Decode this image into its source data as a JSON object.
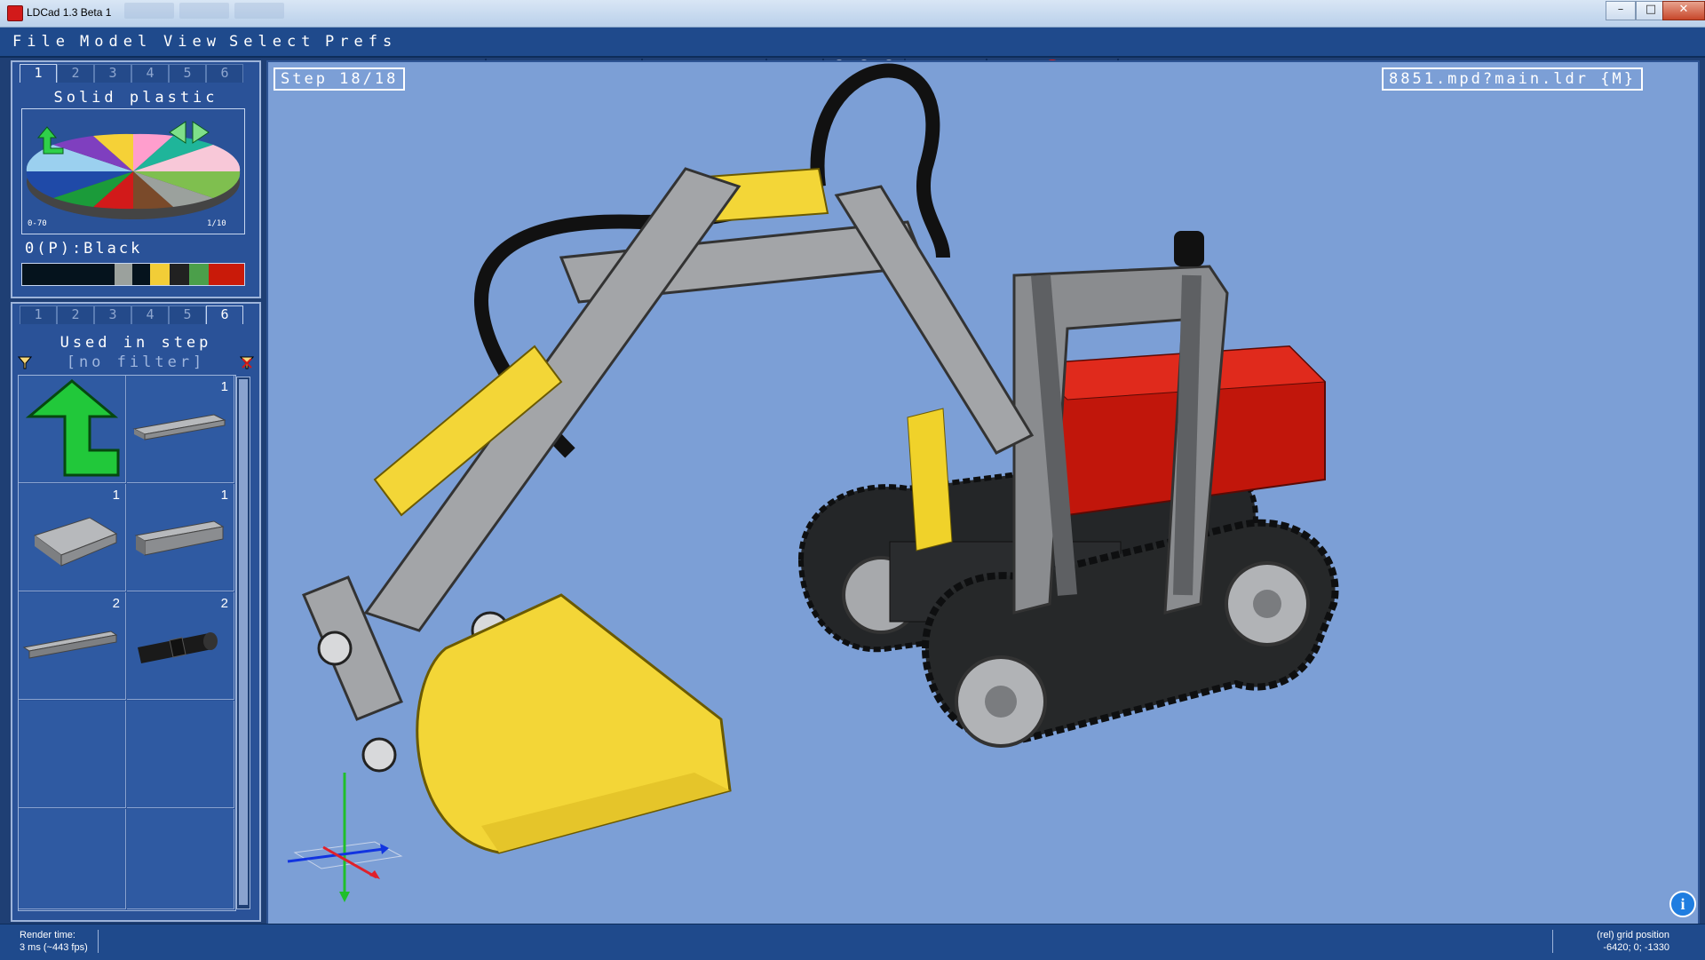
{
  "window": {
    "title": "LDCad 1.3 Beta 1",
    "controls": [
      "minimize",
      "maximize",
      "close"
    ]
  },
  "menu": [
    "File",
    "Model",
    "View",
    "Select",
    "Prefs"
  ],
  "toolbar_icons": [
    "open-icon",
    "save-icon",
    "save-all-icon",
    "undo-icon",
    "redo-icon",
    "copy-icon",
    "cut-icon",
    "paste-icon",
    "paste-special-icon",
    "first-step-icon",
    "prev-step-icon",
    "next-step-icon",
    "last-step-icon",
    "add-step-icon",
    "group-icon",
    "ungroup-icon",
    "color-picker-icon",
    "color-replace-icon",
    "color-edit-icon",
    "hide-icon",
    "unhide-icon",
    "isolate-icon",
    "snap-grid-icon",
    "move-icon",
    "rotate-icon",
    "pan-icon",
    "grid-icon",
    "favorite-icon",
    "favorite-add-icon"
  ],
  "color_bin": {
    "tabs": [
      "1",
      "2",
      "3",
      "4",
      "5",
      "6"
    ],
    "active_tab": "1",
    "title": "Solid plastic",
    "range_label": "0-70",
    "page_label": "1/10",
    "current_color": "0(P):Black",
    "swatches": [
      "#05131d",
      "#05131d",
      "#9ba19d",
      "#05131d",
      "#f2cd37",
      "#212121",
      "#4b9f4a",
      "#c91a09"
    ]
  },
  "parts_bin": {
    "tabs": [
      "1",
      "2",
      "3",
      "4",
      "5",
      "6"
    ],
    "active_tab": "6",
    "title": "Used in step",
    "filter": "[no filter]",
    "items": [
      {
        "name": "up-arrow",
        "count": ""
      },
      {
        "name": "technic-plate-1x8",
        "count": "1"
      },
      {
        "name": "plate-4x4",
        "count": "1"
      },
      {
        "name": "technic-brick-1x6",
        "count": "1"
      },
      {
        "name": "technic-beam-1x14",
        "count": "2"
      },
      {
        "name": "technic-pin-black",
        "count": "2"
      }
    ]
  },
  "viewport": {
    "step": "Step 18/18",
    "model_path": "8851.mpd?main.ldr {M}"
  },
  "status": {
    "render_label": "Render time:",
    "render_value": "3 ms (~443 fps)",
    "grid_label": "(rel) grid position",
    "grid_value": "-6420; 0; -1330"
  }
}
